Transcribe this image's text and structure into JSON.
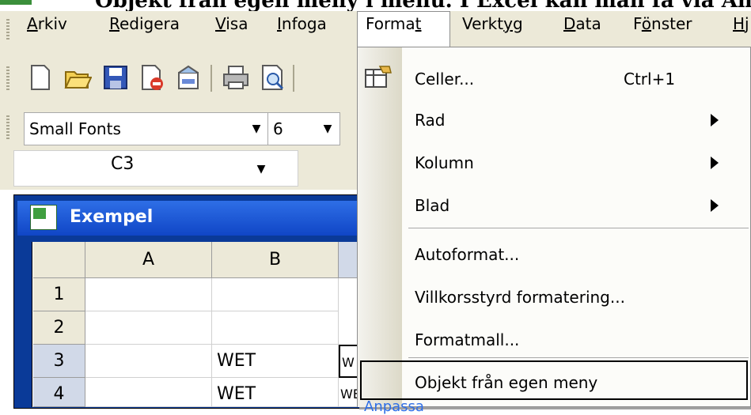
{
  "caption": {
    "text": "Objekt från egen meny i menu. I Excel kan man få via Anpassa"
  },
  "menubar": {
    "items": [
      {
        "label": "Arkiv",
        "key": "A"
      },
      {
        "label": "Redigera",
        "key": "R"
      },
      {
        "label": "Visa",
        "key": "V"
      },
      {
        "label": "Infoga",
        "key": "I"
      },
      {
        "label": "Format",
        "key": "t"
      },
      {
        "label": "Verktyg",
        "key": "y"
      },
      {
        "label": "Data",
        "key": "D"
      },
      {
        "label": "Fönster",
        "key": "ö"
      },
      {
        "label": "Hj",
        "key": "H"
      }
    ]
  },
  "toolbar": {
    "icons": [
      "new-document-icon",
      "open-folder-icon",
      "save-icon",
      "permission-icon",
      "email-icon",
      "print-icon",
      "print-preview-icon"
    ]
  },
  "formatting": {
    "font_name": "Small Fonts",
    "font_size": "6"
  },
  "namebox": {
    "value": "C3"
  },
  "workbook": {
    "title": "Exempel",
    "columns": [
      "A",
      "B"
    ],
    "rows": [
      {
        "num": "1",
        "A": "",
        "B": ""
      },
      {
        "num": "2",
        "A": "",
        "B": ""
      },
      {
        "num": "3",
        "A": "",
        "B": "WET"
      },
      {
        "num": "4",
        "A": "",
        "B": "WET"
      }
    ],
    "partial_c": [
      "W",
      "WE"
    ]
  },
  "format_menu": {
    "items": [
      {
        "label": "Celler...",
        "shortcut": "Ctrl+1",
        "submenu": false,
        "icon": "format-cells-icon"
      },
      {
        "label": "Rad",
        "shortcut": "",
        "submenu": true
      },
      {
        "label": "Kolumn",
        "shortcut": "",
        "submenu": true
      },
      {
        "label": "Blad",
        "shortcut": "",
        "submenu": true
      },
      {
        "label": "Autoformat...",
        "shortcut": "",
        "submenu": false
      },
      {
        "label": "Villkorsstyrd formatering...",
        "shortcut": "",
        "submenu": false
      },
      {
        "label": "Formatmall...",
        "shortcut": "",
        "submenu": false
      },
      {
        "label": "Objekt från egen meny",
        "shortcut": "",
        "submenu": false,
        "highlighted": true
      }
    ],
    "partial_toolbar_glyph": "%",
    "partial_anpassa": "Anpassa"
  }
}
